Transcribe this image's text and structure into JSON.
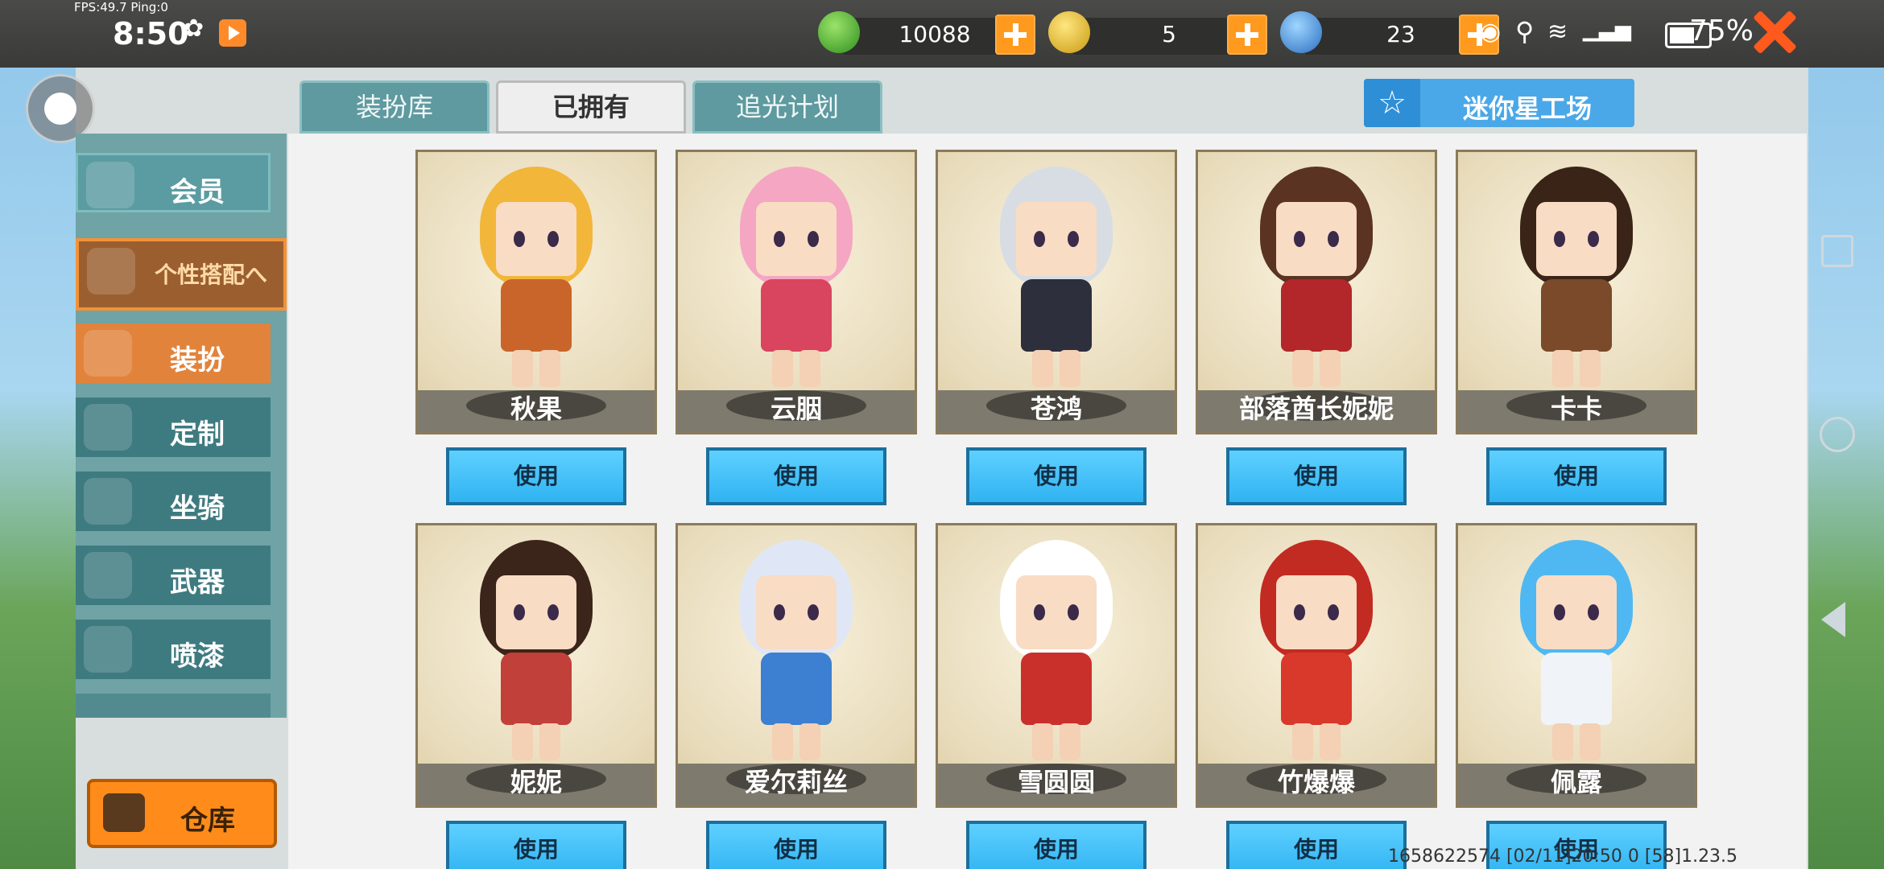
{
  "status_bar": {
    "fps": "FPS:49.7  Ping:0",
    "time": "8:50",
    "battery_pct": "75%",
    "battery_level": 0.75
  },
  "currencies": [
    {
      "name": "mini-bean",
      "value": "10088",
      "color": "#3fae2c"
    },
    {
      "name": "mini-coin",
      "value": "5",
      "color": "#e8b923"
    },
    {
      "name": "mini-point",
      "value": "23",
      "color": "#3a8fe0"
    }
  ],
  "tabs": [
    {
      "label": "装扮库",
      "active": false
    },
    {
      "label": "已拥有",
      "active": true
    },
    {
      "label": "追光计划",
      "active": false
    }
  ],
  "workshop_button": "迷你星工场",
  "sidebar": {
    "items": [
      {
        "label": "会员"
      },
      {
        "label": "个性搭配へ"
      },
      {
        "label": "装扮"
      },
      {
        "label": "定制"
      },
      {
        "label": "坐骑"
      },
      {
        "label": "武器"
      },
      {
        "label": "喷漆"
      }
    ],
    "warehouse": "仓库"
  },
  "use_label": "使用",
  "skins": [
    {
      "name": "秋果",
      "hair": "#f2b63a",
      "body": "#c9652a"
    },
    {
      "name": "云胭",
      "hair": "#f5a6c2",
      "body": "#d9455e"
    },
    {
      "name": "苍鸿",
      "hair": "#d8dde3",
      "body": "#2d2f3d"
    },
    {
      "name": "部落酋长妮妮",
      "hair": "#5a3322",
      "body": "#b3262a"
    },
    {
      "name": "卡卡",
      "hair": "#3a2418",
      "body": "#7a4a2a"
    },
    {
      "name": "妮妮",
      "hair": "#3b2419",
      "body": "#c2403a"
    },
    {
      "name": "爱尔莉丝",
      "hair": "#dfe7f7",
      "body": "#3d7fd0"
    },
    {
      "name": "雪圆圆",
      "hair": "#ffffff",
      "body": "#c9302c"
    },
    {
      "name": "竹爆爆",
      "hair": "#c22b22",
      "body": "#d8392a"
    },
    {
      "name": "佩露",
      "hair": "#4fb8f2",
      "body": "#f0f4f8"
    }
  ],
  "footer": "1658622574  [02/11]20:50 0  [58]1.23.5"
}
